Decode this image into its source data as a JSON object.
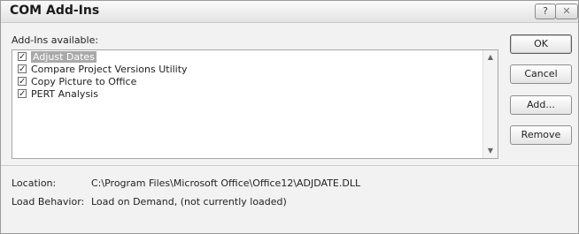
{
  "window": {
    "title": "COM Add-Ins",
    "help_glyph": "?",
    "close_glyph": "✕"
  },
  "addins": {
    "label": "Add-Ins available:",
    "items": [
      {
        "label": "Adjust Dates",
        "checked": true,
        "selected": true
      },
      {
        "label": "Compare Project Versions Utility",
        "checked": true,
        "selected": false
      },
      {
        "label": "Copy Picture to Office",
        "checked": true,
        "selected": false
      },
      {
        "label": "PERT Analysis",
        "checked": true,
        "selected": false
      }
    ],
    "scroll_up_glyph": "▲",
    "scroll_down_glyph": "▼"
  },
  "buttons": {
    "ok": "OK",
    "cancel": "Cancel",
    "add": "Add...",
    "remove": "Remove"
  },
  "details": {
    "location_label": "Location:",
    "location_value": "C:\\Program Files\\Microsoft Office\\Office12\\ADJDATE.DLL",
    "behavior_label": "Load Behavior:",
    "behavior_value": "Load on Demand, (not currently loaded)"
  },
  "icons": {
    "check": "check-icon"
  }
}
